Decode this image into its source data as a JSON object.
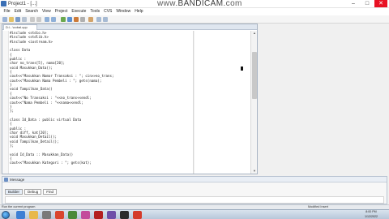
{
  "window": {
    "title": "Project1 - [...]",
    "controls": [
      "–",
      "□",
      "✕"
    ]
  },
  "watermark": {
    "part1": "www.",
    "part2": "BANDICAM",
    "part3": ".com"
  },
  "menu": [
    "File",
    "Edit",
    "Search",
    "View",
    "Project",
    "Execute",
    "Tools",
    "CVS",
    "Window",
    "Help"
  ],
  "editor": {
    "tab_label": "D:\\...\\cobal.cpp"
  },
  "code": [
    "#include <stdio.h>",
    "#include <stdlib.h>",
    "#include <iostream.h>",
    "",
    "class Data",
    "{",
    "public :",
    "char no_trans[5], nama[20];",
    "void Masukkan_Data();",
    "{",
    "cout<<\"Masukkan Nomor Transaksi : \"; cin>>no_trans;",
    "cout<<\"Masukkan Nama Pembeli : \"; gets(nama);",
    "}",
    "void Tampilkan_Data()",
    "{",
    "cout<<\"No Transaksi : \"<<no_trans<<endl;",
    "cout<<\"Nama Pembeli : \"<<nama<<endl;",
    "}",
    "};",
    "",
    "class Id_Data : public virtual Data",
    "{",
    "public :",
    "char diff, kat[20];",
    "void Masukkan_Detail();",
    "void Tampilkan_Detail();",
    "};",
    "",
    "void Id_Data :: Masukkan_Data()",
    "{",
    "cout<<\"Masukkan Kategori : \"; gets(kat);"
  ],
  "message_panel": {
    "title": "Message",
    "tabs": [
      "Builder",
      "Debug",
      "Find"
    ]
  },
  "status": {
    "left": "Run the current program",
    "right": "Modified     Insert"
  },
  "taskbar": {
    "time": "8:00 PM",
    "date": "1/12/2022"
  }
}
